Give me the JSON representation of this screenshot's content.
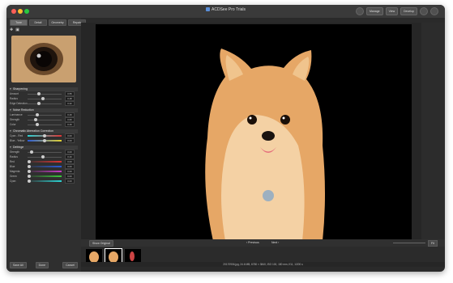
{
  "window_title": "ACDSee Pro Trials",
  "top_buttons": [
    "Manage",
    "View",
    "Develop"
  ],
  "tabs": [
    "Tune",
    "Detail",
    "Geometry",
    "Repair"
  ],
  "sections": [
    {
      "title": "Sharpening",
      "rows": [
        [
          "Amount",
          "0.30",
          "0.55"
        ],
        [
          "Radius",
          "0.40",
          "0.48"
        ],
        [
          "Edge Detection",
          "0.30",
          "0.42"
        ]
      ]
    },
    {
      "title": "Noise Reduction",
      "rows": [
        [
          "Luminance",
          "0.25",
          "0.40"
        ],
        [
          "Strength",
          "0.20",
          "0.60"
        ],
        [
          "Color",
          "0.25",
          "0.40"
        ]
      ]
    },
    {
      "title": "Chromatic Aberration Correction",
      "rows": [
        [
          "Cyan - Red",
          "0.50",
          "0.00"
        ],
        [
          "Blue - Yellow",
          "0.50",
          "0.00"
        ]
      ]
    },
    {
      "title": "Defringe",
      "rows": [
        [
          "Strength",
          "0.10",
          "0.00"
        ],
        [
          "Radius",
          "0.45",
          "0.40"
        ],
        [
          "Red",
          "0.00",
          "0.00"
        ],
        [
          "Blue",
          "0.00",
          "0.00"
        ],
        [
          "Magenta",
          "0.00",
          "0.00"
        ],
        [
          "Green",
          "0.00",
          "0.00"
        ],
        [
          "Cyan",
          "0.00",
          "0.00"
        ]
      ]
    }
  ],
  "bottom_left": [
    "Save All",
    "Done",
    "Cancel"
  ],
  "nav": {
    "show_original": "Show Original",
    "previous": "Previous",
    "next": "Next",
    "zoom": "Fit"
  },
  "status": "20170906.jpg, 24.6 MB, 6780 × 3840, ISO 100, 180 mm, f/11, 1/200 s",
  "accent": "#5a8ed8"
}
